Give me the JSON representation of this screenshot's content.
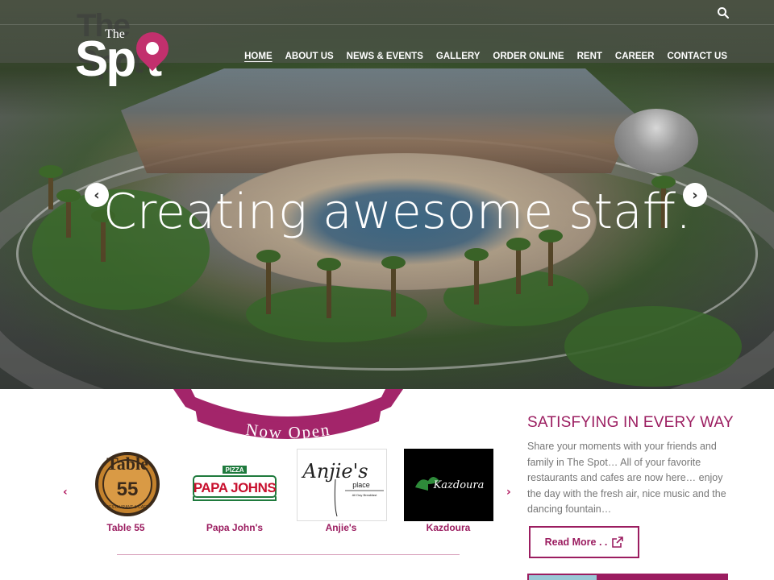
{
  "logo": {
    "ghost_text": "The Spot",
    "the": "The",
    "spot": "Sp t"
  },
  "nav": {
    "items": [
      "HOME",
      "ABOUT US",
      "NEWS & EVENTS",
      "GALLERY",
      "ORDER ONLINE",
      "RENT",
      "CAREER",
      "CONTACT US"
    ],
    "active": "HOME"
  },
  "hero": {
    "headline": "Creating awesome staff.",
    "prev_glyph": "‹",
    "next_glyph": "›"
  },
  "ribbon": {
    "text": "Now Open"
  },
  "carousel": {
    "prev_glyph": "‹",
    "next_glyph": "›",
    "brands": [
      {
        "name": "Table 55",
        "logo_text": "Table",
        "logo_number": "55",
        "logo_sub": "RESTAURANT & CAFE"
      },
      {
        "name": "Papa John's",
        "logo_top": "PIZZA",
        "logo_text": "PAPA JOHNS"
      },
      {
        "name": "Anjie's",
        "logo_text": "Anjie's",
        "logo_sub": "place",
        "logo_tagline": "All Day Breakfast"
      },
      {
        "name": "Kazdoura",
        "logo_text": "Kazdoura"
      }
    ]
  },
  "side": {
    "title": "SATISFYING IN EVERY WAY",
    "text": "Share your moments with your friends and family in The Spot… All of your favorite restaurants and cafes are now here… enjoy the day with the fresh air, nice music and the dancing fountain…",
    "button": "Read More . ."
  },
  "colors": {
    "accent": "#9b1d60",
    "pin": "#c2306d"
  }
}
